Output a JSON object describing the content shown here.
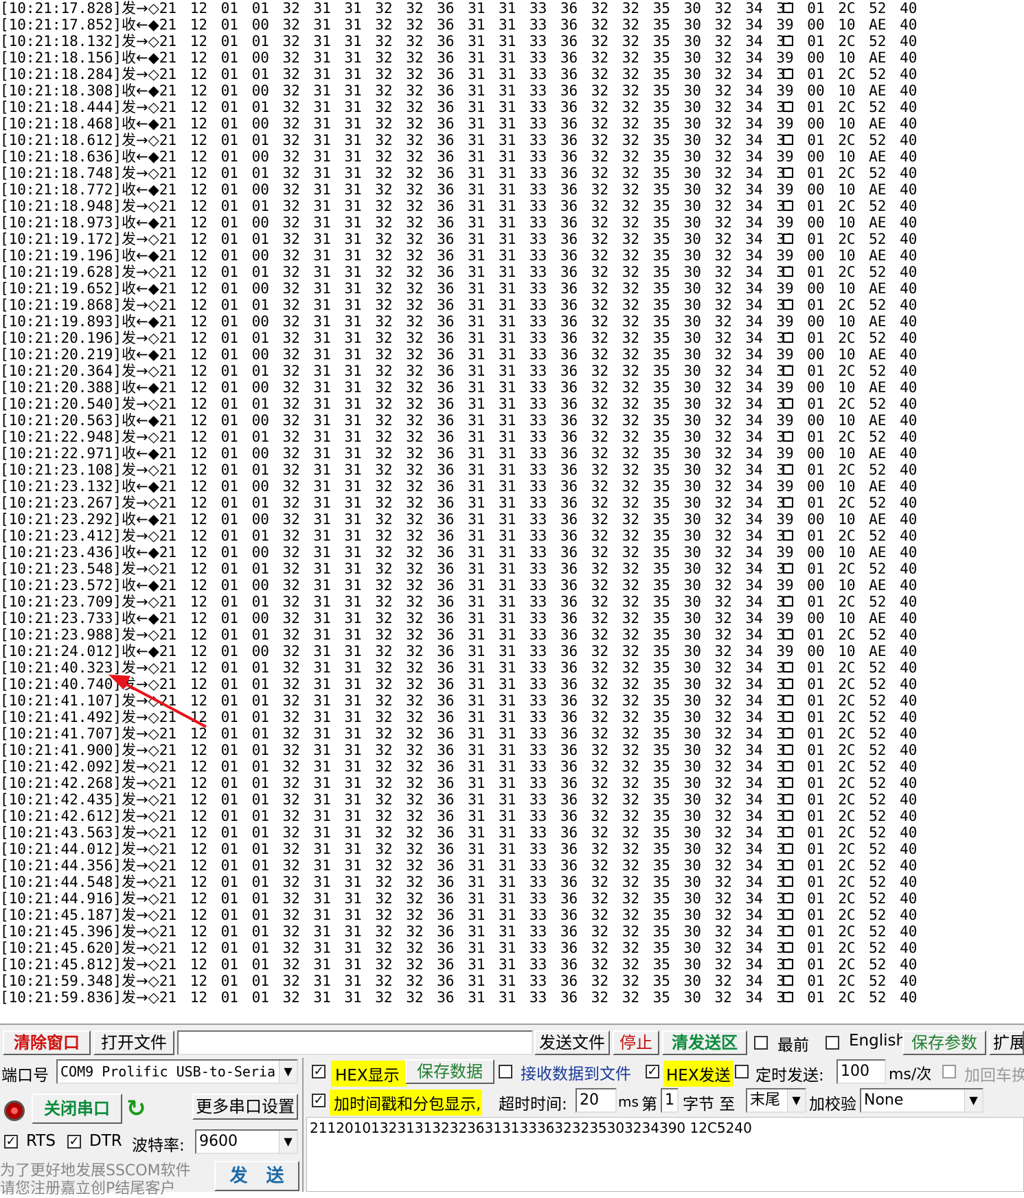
{
  "log": {
    "send_dir": "发",
    "recv_dir": "收",
    "send_arrow": "→",
    "recv_arrow": "←",
    "send_mark": "◇",
    "recv_mark": "◆",
    "send_hex": "21 12 01 01 32 31 31 32 32 36 31 31 33 36 32 32 35 30 32 34 39 01 2C 52 40",
    "recv_hex": "21 12 01 00 32 31 31 32 32 36 31 31 33 36 32 32 35 30 32 34 39 00 10 AE 40",
    "rows": [
      {
        "ts": "[10:21:17.828]",
        "dir": "send"
      },
      {
        "ts": "[10:21:17.852]",
        "dir": "recv"
      },
      {
        "ts": "[10:21:18.132]",
        "dir": "send"
      },
      {
        "ts": "[10:21:18.156]",
        "dir": "recv"
      },
      {
        "ts": "[10:21:18.284]",
        "dir": "send"
      },
      {
        "ts": "[10:21:18.308]",
        "dir": "recv"
      },
      {
        "ts": "[10:21:18.444]",
        "dir": "send"
      },
      {
        "ts": "[10:21:18.468]",
        "dir": "recv"
      },
      {
        "ts": "[10:21:18.612]",
        "dir": "send"
      },
      {
        "ts": "[10:21:18.636]",
        "dir": "recv"
      },
      {
        "ts": "[10:21:18.748]",
        "dir": "send"
      },
      {
        "ts": "[10:21:18.772]",
        "dir": "recv"
      },
      {
        "ts": "[10:21:18.948]",
        "dir": "send"
      },
      {
        "ts": "[10:21:18.973]",
        "dir": "recv"
      },
      {
        "ts": "[10:21:19.172]",
        "dir": "send"
      },
      {
        "ts": "[10:21:19.196]",
        "dir": "recv"
      },
      {
        "ts": "[10:21:19.628]",
        "dir": "send"
      },
      {
        "ts": "[10:21:19.652]",
        "dir": "recv"
      },
      {
        "ts": "[10:21:19.868]",
        "dir": "send"
      },
      {
        "ts": "[10:21:19.893]",
        "dir": "recv"
      },
      {
        "ts": "[10:21:20.196]",
        "dir": "send"
      },
      {
        "ts": "[10:21:20.219]",
        "dir": "recv"
      },
      {
        "ts": "[10:21:20.364]",
        "dir": "send"
      },
      {
        "ts": "[10:21:20.388]",
        "dir": "recv"
      },
      {
        "ts": "[10:21:20.540]",
        "dir": "send"
      },
      {
        "ts": "[10:21:20.563]",
        "dir": "recv"
      },
      {
        "ts": "[10:21:22.948]",
        "dir": "send"
      },
      {
        "ts": "[10:21:22.971]",
        "dir": "recv"
      },
      {
        "ts": "[10:21:23.108]",
        "dir": "send"
      },
      {
        "ts": "[10:21:23.132]",
        "dir": "recv"
      },
      {
        "ts": "[10:21:23.267]",
        "dir": "send"
      },
      {
        "ts": "[10:21:23.292]",
        "dir": "recv"
      },
      {
        "ts": "[10:21:23.412]",
        "dir": "send"
      },
      {
        "ts": "[10:21:23.436]",
        "dir": "recv"
      },
      {
        "ts": "[10:21:23.548]",
        "dir": "send"
      },
      {
        "ts": "[10:21:23.572]",
        "dir": "recv"
      },
      {
        "ts": "[10:21:23.709]",
        "dir": "send"
      },
      {
        "ts": "[10:21:23.733]",
        "dir": "recv"
      },
      {
        "ts": "[10:21:23.988]",
        "dir": "send"
      },
      {
        "ts": "[10:21:24.012]",
        "dir": "recv"
      },
      {
        "ts": "[10:21:40.323]",
        "dir": "send"
      },
      {
        "ts": "[10:21:40.740]",
        "dir": "send"
      },
      {
        "ts": "[10:21:41.107]",
        "dir": "send"
      },
      {
        "ts": "[10:21:41.492]",
        "dir": "send"
      },
      {
        "ts": "[10:21:41.707]",
        "dir": "send"
      },
      {
        "ts": "[10:21:41.900]",
        "dir": "send"
      },
      {
        "ts": "[10:21:42.092]",
        "dir": "send"
      },
      {
        "ts": "[10:21:42.268]",
        "dir": "send"
      },
      {
        "ts": "[10:21:42.435]",
        "dir": "send"
      },
      {
        "ts": "[10:21:42.612]",
        "dir": "send"
      },
      {
        "ts": "[10:21:43.563]",
        "dir": "send"
      },
      {
        "ts": "[10:21:44.012]",
        "dir": "send"
      },
      {
        "ts": "[10:21:44.356]",
        "dir": "send"
      },
      {
        "ts": "[10:21:44.548]",
        "dir": "send"
      },
      {
        "ts": "[10:21:44.916]",
        "dir": "send"
      },
      {
        "ts": "[10:21:45.187]",
        "dir": "send"
      },
      {
        "ts": "[10:21:45.396]",
        "dir": "send"
      },
      {
        "ts": "[10:21:45.620]",
        "dir": "send"
      },
      {
        "ts": "[10:21:45.812]",
        "dir": "send"
      },
      {
        "ts": "[10:21:59.348]",
        "dir": "send"
      },
      {
        "ts": "[10:21:59.836]",
        "dir": "send"
      }
    ]
  },
  "annotation": {
    "color": "#e8141b"
  },
  "toolbar": {
    "clear_window": "清除窗口",
    "open_file": "打开文件",
    "file_path": "",
    "send_file": "发送文件",
    "stop": "停止",
    "clear_send": "清发送区",
    "topmost_label": "最前",
    "english_label": "English",
    "save_params": "保存参数",
    "expand": "扩展"
  },
  "port": {
    "port_label": "端口号",
    "port_value": "COM9 Prolific USB-to-Seria",
    "close_port": "关闭串口",
    "more_settings": "更多串口设置",
    "rts_label": "RTS",
    "dtr_label": "DTR",
    "baud_label": "波特率:",
    "baud_value": "9600",
    "promo_line1": "为了更好地发展SSCOM软件",
    "promo_line2": "请您注册嘉立创P结尾客户",
    "send_button": "发 送"
  },
  "options": {
    "hex_display": "HEX显示",
    "save_data": "保存数据",
    "recv_to_file": "接收数据到文件",
    "hex_send": "HEX发送",
    "timed_send": "定时发送:",
    "interval_value": "100",
    "interval_unit": "ms/次",
    "add_crlf": "加回车换",
    "timestamp": "加时间戳和分包显示,",
    "timeout_label": "超时时间:",
    "timeout_value": "20",
    "timeout_unit": "ms",
    "from_label": "第",
    "from_value": "1",
    "byte_label": "字节 至",
    "to_value": "末尾",
    "checksum_label": "加校验",
    "checksum_value": "None"
  },
  "send_area": {
    "text": "2112010132313132323631313336323235303234390 12C5240"
  }
}
